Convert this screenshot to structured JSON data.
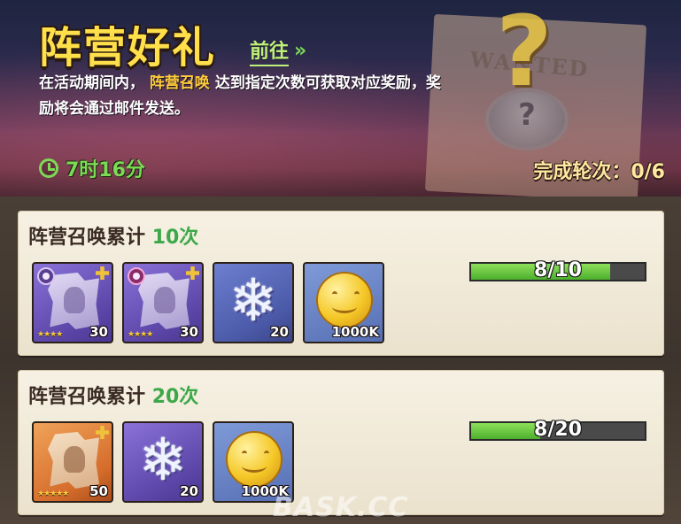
{
  "header": {
    "title": "阵营好礼",
    "goto_label": "前往",
    "goto_chevron": "»",
    "desc_before": "在活动期间内，",
    "desc_highlight": "阵营召唤",
    "desc_after": "达到指定次数可获取对应奖励，奖励将会通过邮件发送。",
    "timer": "7时16分",
    "progress": "完成轮次：0/6",
    "poster_text": "WANTED",
    "poster_mark": "?"
  },
  "tasks": [
    {
      "title_prefix": "阵营召唤累计",
      "count": "10次",
      "progress_text": "8/10",
      "progress_fraction": 0.8,
      "rewards": [
        {
          "icon": "light-faction-shard-icon",
          "stars": "★★★★",
          "qty": "30"
        },
        {
          "icon": "dark-faction-shard-icon",
          "stars": "★★★★",
          "qty": "30"
        },
        {
          "icon": "snowflake-icon",
          "qty": "20"
        },
        {
          "icon": "gold-coin-icon",
          "qty": "1000K"
        }
      ]
    },
    {
      "title_prefix": "阵营召唤累计",
      "count": "20次",
      "progress_text": "8/20",
      "progress_fraction": 0.4,
      "rewards": [
        {
          "icon": "faction-shard-icon",
          "stars": "★★★★★",
          "qty": "50"
        },
        {
          "icon": "snowflake-icon",
          "qty": "20"
        },
        {
          "icon": "gold-coin-icon",
          "qty": "1000K"
        }
      ]
    }
  ],
  "watermark": "BASK.CC",
  "colors": {
    "title": "#ffe04a",
    "highlight": "#ffcc3d",
    "green": "#7ed957",
    "count_green": "#3da84a"
  }
}
